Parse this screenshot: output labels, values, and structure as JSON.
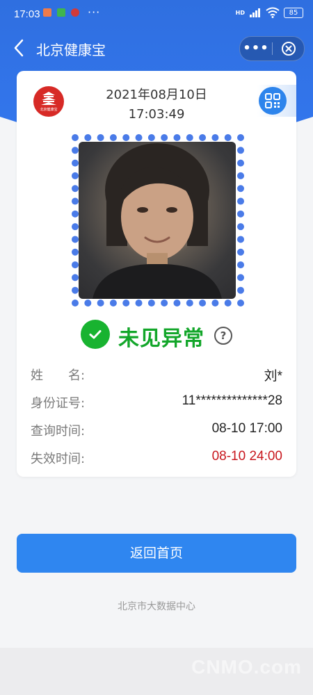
{
  "status_bar": {
    "time": "17:03",
    "more": "···",
    "network": "HD",
    "battery": "85"
  },
  "nav": {
    "title": "北京健康宝"
  },
  "card": {
    "logo_text": "北京健康宝",
    "date": "2021年08月10日",
    "time": "17:03:49",
    "status": "未见异常",
    "help": "?",
    "fields": [
      {
        "label": "姓　　名:",
        "value": "刘*"
      },
      {
        "label": "身份证号:",
        "value": "11**************28"
      },
      {
        "label": "查询时间:",
        "value": "08-10 17:00"
      },
      {
        "label": "失效时间:",
        "value": "08-10 24:00"
      }
    ]
  },
  "home_button": "返回首页",
  "footer": "北京市大数据中心",
  "watermark": "CNMO.com",
  "colors": {
    "header_blue": "#2f6fe0",
    "status_green": "#13a62a",
    "expire_red": "#c8161d",
    "button_blue": "#2f86f0"
  }
}
